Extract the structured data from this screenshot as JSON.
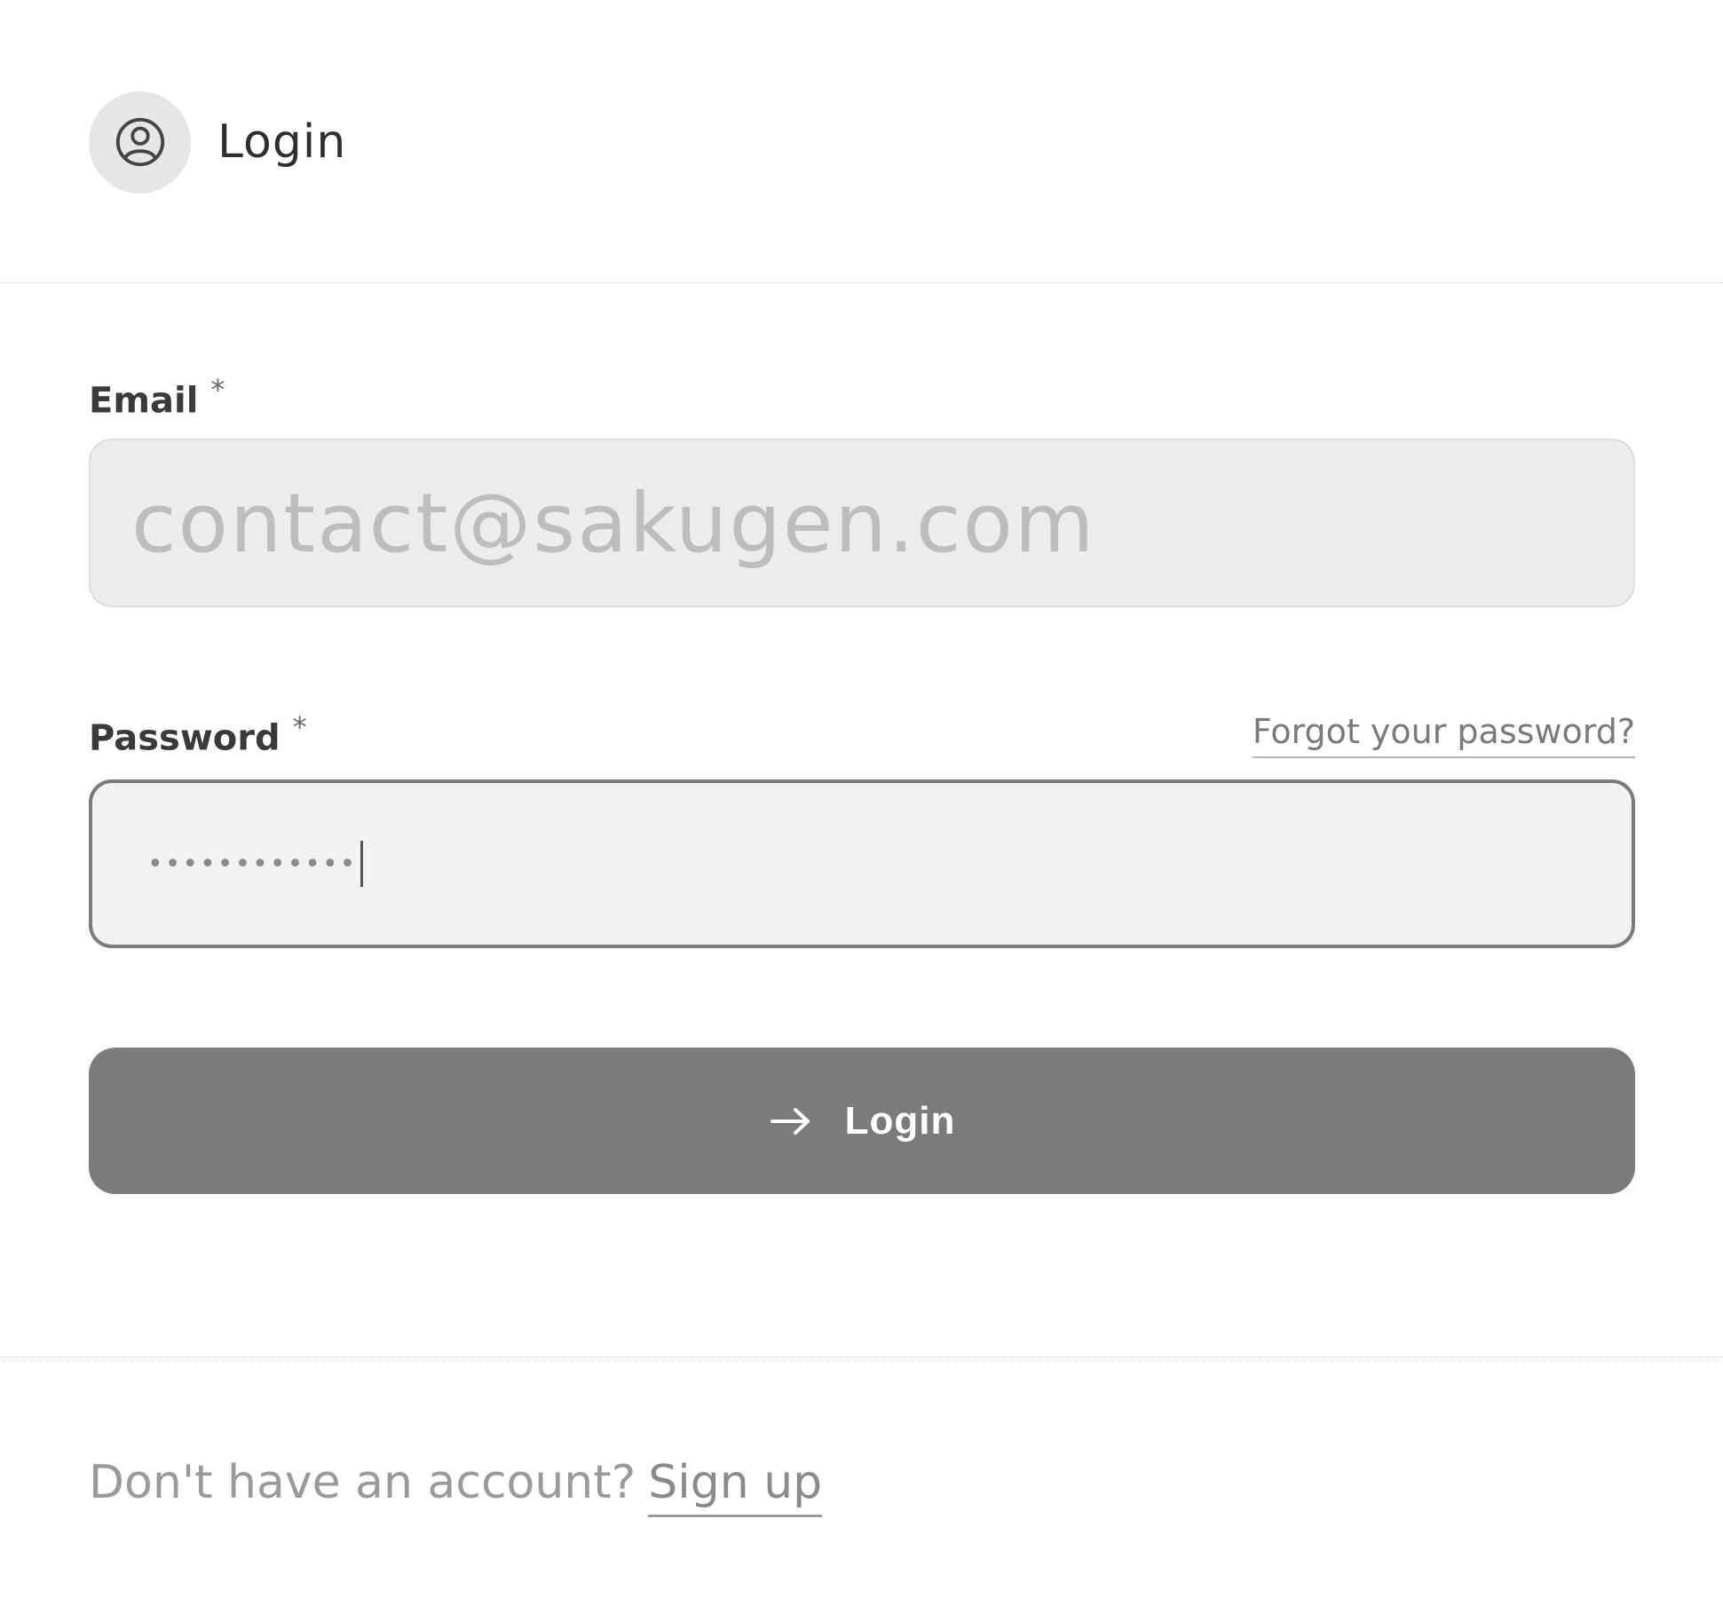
{
  "header": {
    "title": "Login",
    "icon": "user-circle-icon"
  },
  "email": {
    "label": "Email",
    "required_mark": "*",
    "value": "contact@sakugen.com"
  },
  "password": {
    "label": "Password",
    "required_mark": "*",
    "value": "••••••••••••",
    "forgot_label": "Forgot your password?"
  },
  "login_button": {
    "label": "Login",
    "icon": "arrow-right-icon"
  },
  "footer": {
    "prompt": "Don't have an account?",
    "signup_label": "Sign up"
  },
  "colors": {
    "button_bg": "#7b7b7b",
    "input_bg": "#ececec",
    "focused_border": "#7a7a7a"
  }
}
